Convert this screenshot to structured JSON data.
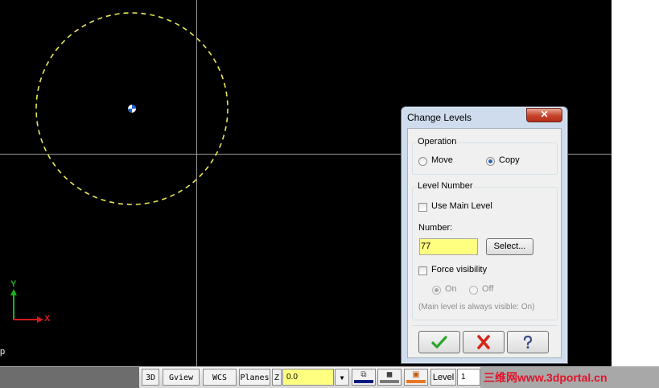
{
  "viewport": {
    "axis_y_label": "Y",
    "axis_x_label": "X",
    "edge_glyph": "p"
  },
  "statusbar": {
    "btn_3d": "3D",
    "btn_gview": "Gview",
    "btn_wcs": "WCS",
    "btn_planes": "Planes",
    "z_label": "Z",
    "z_value": "0.0",
    "dropdown_arrow": "▼",
    "level_label": "Level",
    "level_value": "1",
    "watermark": "三维网www.3dportal.cn",
    "colors": {
      "main_color": "#001a80",
      "point_color": "#7a7a7a",
      "line_color": "#e87722"
    }
  },
  "dialog": {
    "title": "Change Levels",
    "close_glyph": "✕",
    "operation": {
      "label": "Operation",
      "move_label": "Move",
      "copy_label": "Copy",
      "selected": "Copy"
    },
    "level_number": {
      "label": "Level Number",
      "use_main_level_label": "Use Main Level",
      "use_main_level_checked": false,
      "number_label": "Number:",
      "number_value": "77",
      "select_button": "Select...",
      "force_visibility_label": "Force visibility",
      "force_visibility_checked": false,
      "on_label": "On",
      "off_label": "Off",
      "note": "(Main level is always visible: On)"
    },
    "buttons": {
      "ok_icon": "check-icon",
      "cancel_icon": "x-icon",
      "help_icon": "question-icon"
    }
  }
}
